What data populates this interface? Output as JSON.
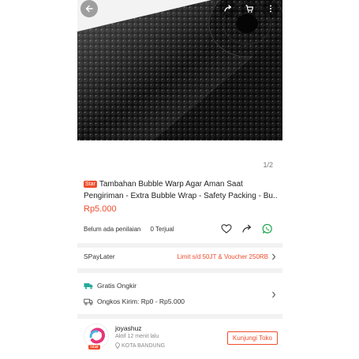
{
  "gallery": {
    "counter": "1/2"
  },
  "product": {
    "badge": "Star",
    "title_line1": "Tambahan Bubble Warp Agar Aman Saat",
    "title_line2": "Pengiriman - Extra Bubble Wrap - Safety Packing - Bu...",
    "price": "Rp5.000",
    "rating_text": "Belum ada penilaian",
    "sold_text": "0 Terjual"
  },
  "spaylater": {
    "label": "SPayLater",
    "promo": "Limit s/d 50JT & Voucher 250RB"
  },
  "shipping": {
    "free_label": "Gratis Ongkir",
    "cost_label": "Ongkos Kirim: Rp0 - Rp5.000"
  },
  "shop": {
    "badge": "Star",
    "name": "joyashuz",
    "active": "Aktif 12 menit lalu",
    "location": "KOTA BANDUNG",
    "visit_label": "Kunjungi Toko"
  },
  "colors": {
    "accent": "#ee4d2d",
    "shipping_icon": "#26aa99"
  }
}
